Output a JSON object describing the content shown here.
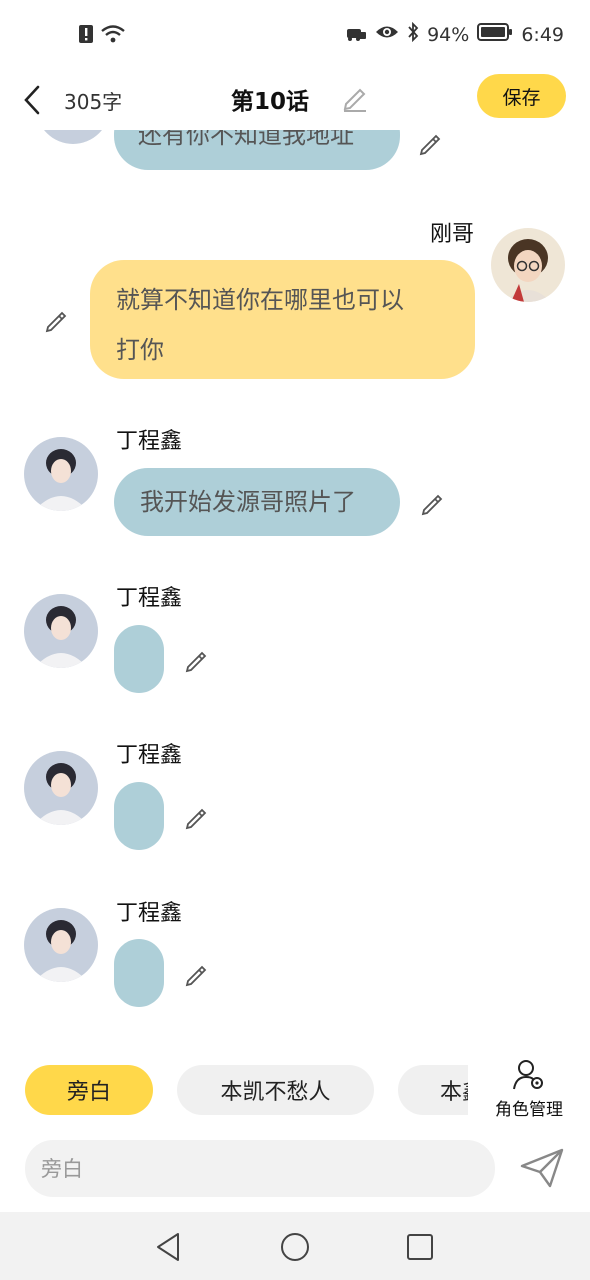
{
  "status_bar": {
    "battery_percent": "94%",
    "time": "6:49",
    "icons": [
      "sim-alert-icon",
      "wifi-icon",
      "lock-car-icon",
      "eye-icon",
      "bluetooth-icon",
      "battery-icon"
    ]
  },
  "header": {
    "word_count": "305字",
    "title": "第10话",
    "save_label": "保存"
  },
  "messages": [
    {
      "side": "left",
      "speaker": "",
      "text": "还有你不知道我地址",
      "partial": true
    },
    {
      "side": "right",
      "speaker": "刚哥",
      "text_line1": "就算不知道你在哪里也可以",
      "text_line2": "打你"
    },
    {
      "side": "left",
      "speaker": "丁程鑫",
      "text": "我开始发源哥照片了"
    },
    {
      "side": "left",
      "speaker": "丁程鑫",
      "text": ""
    },
    {
      "side": "left",
      "speaker": "丁程鑫",
      "text": ""
    },
    {
      "side": "left",
      "speaker": "丁程鑫",
      "text": ""
    }
  ],
  "role_tabs": [
    "旁白",
    "本凯不愁人",
    "本鑫"
  ],
  "role_manage_label": "角色管理",
  "input": {
    "placeholder": "旁白",
    "value": ""
  },
  "colors": {
    "accent_yellow": "#FFD84A",
    "bubble_blue": "#AECFD8",
    "bubble_yellow": "#FFE08C"
  }
}
